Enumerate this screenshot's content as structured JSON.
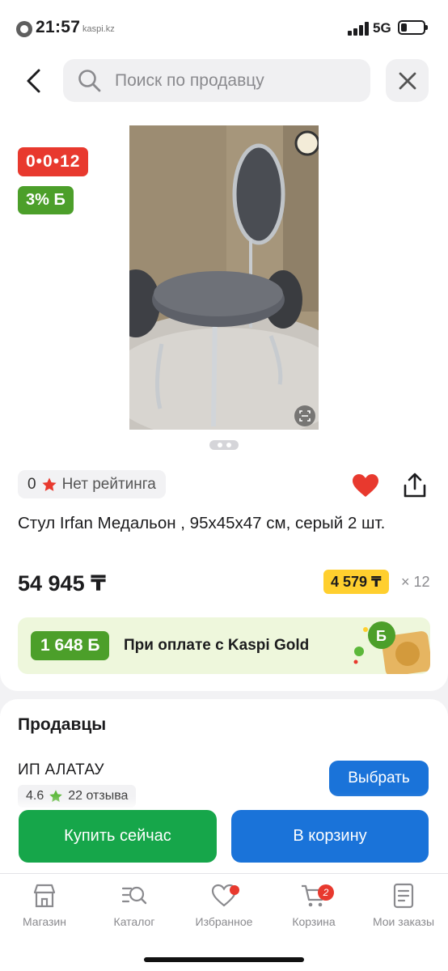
{
  "status_bar": {
    "time": "21:57",
    "carrier_ghost": "kaspi.kz",
    "network": "5G"
  },
  "header": {
    "search_placeholder": "Поиск по продавцу"
  },
  "product": {
    "timer": "0•0•12",
    "bonus_badge": "3% Б",
    "rating_value": "0",
    "rating_text": "Нет рейтинга",
    "title": "Стул Irfan Медальон , 95х45х47 см, серый 2 шт.",
    "price": "54 945 ₸",
    "installment_price": "4 579 ₸",
    "installment_months": "× 12",
    "gold_bonus": "1 648 Б",
    "gold_text": "При оплате с Kaspi Gold",
    "favorite_color": "#e8392e"
  },
  "sellers": {
    "heading": "Продавцы",
    "items": [
      {
        "name": "ИП АЛАТАУ",
        "rating": "4.6",
        "reviews": "22 отзыва",
        "button": "Выбрать"
      }
    ]
  },
  "actions": {
    "buy_now": "Купить сейчас",
    "add_to_cart": "В корзину"
  },
  "tabbar": {
    "items": [
      {
        "label": "Магазин",
        "icon": "shop-icon"
      },
      {
        "label": "Каталог",
        "icon": "catalog-search-icon"
      },
      {
        "label": "Избранное",
        "icon": "heart-icon",
        "dot": true
      },
      {
        "label": "Корзина",
        "icon": "cart-icon",
        "badge": "2"
      },
      {
        "label": "Мои заказы",
        "icon": "orders-icon"
      }
    ]
  },
  "colors": {
    "primary_blue": "#1a73d9",
    "buy_green": "#16a64a",
    "bonus_green": "#4c9f2a",
    "timer_red": "#e8392e",
    "installment_yellow": "#ffcf2e"
  }
}
